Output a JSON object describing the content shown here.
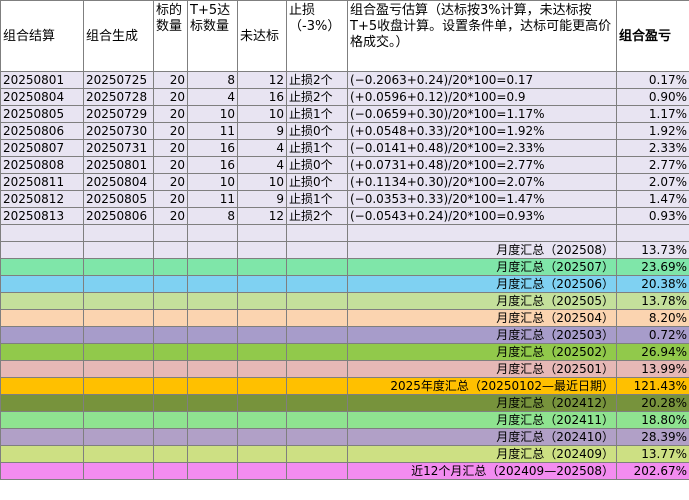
{
  "headers": {
    "col1": "组合结算",
    "col2": "组合生成",
    "col3": "标的数量",
    "col4": "T+5达标数量",
    "col5": "未达标",
    "col6": "止损（-3%）",
    "col7": "组合盈亏估算（达标按3%计算，未达标按T+5收盘计算。设置条件单，达标可能更高价格成交。）",
    "col8": "组合盈亏"
  },
  "rows": [
    {
      "settle": "20250801",
      "gen": "20250725",
      "count": "20",
      "hit": "8",
      "miss": "12",
      "stop": "止损2个",
      "calc": "(−0.2063+0.24)/20*100=0.17",
      "pnl": "0.17%"
    },
    {
      "settle": "20250804",
      "gen": "20250728",
      "count": "20",
      "hit": "4",
      "miss": "16",
      "stop": "止损2个",
      "calc": "(+0.0596+0.12)/20*100=0.9",
      "pnl": "0.90%"
    },
    {
      "settle": "20250805",
      "gen": "20250729",
      "count": "20",
      "hit": "10",
      "miss": "10",
      "stop": "止损1个",
      "calc": "(−0.0659+0.30)/20*100=1.17%",
      "pnl": "1.17%"
    },
    {
      "settle": "20250806",
      "gen": "20250730",
      "count": "20",
      "hit": "11",
      "miss": "9",
      "stop": "止损0个",
      "calc": "(+0.0548+0.33)/20*100=1.92%",
      "pnl": "1.92%"
    },
    {
      "settle": "20250807",
      "gen": "20250731",
      "count": "20",
      "hit": "16",
      "miss": "4",
      "stop": "止损1个",
      "calc": "(−0.0141+0.48)/20*100=2.33%",
      "pnl": "2.33%"
    },
    {
      "settle": "20250808",
      "gen": "20250801",
      "count": "20",
      "hit": "16",
      "miss": "4",
      "stop": "止损0个",
      "calc": "(+0.0731+0.48)/20*100=2.77%",
      "pnl": "2.77%"
    },
    {
      "settle": "20250811",
      "gen": "20250804",
      "count": "20",
      "hit": "10",
      "miss": "10",
      "stop": "止损0个",
      "calc": "(+0.1134+0.30)/20*100=2.07%",
      "pnl": "2.07%"
    },
    {
      "settle": "20250812",
      "gen": "20250805",
      "count": "20",
      "hit": "11",
      "miss": "9",
      "stop": "止损1个",
      "calc": "(−0.0353+0.33)/20*100=1.47%",
      "pnl": "1.47%"
    },
    {
      "settle": "20250813",
      "gen": "20250806",
      "count": "20",
      "hit": "8",
      "miss": "12",
      "stop": "止损2个",
      "calc": "(−0.0543+0.24)/20*100=0.93%",
      "pnl": "0.93%"
    }
  ],
  "summaries": [
    {
      "label": "月度汇总（202508）",
      "value": "13.73%",
      "color": "#e8e4f2"
    },
    {
      "label": "月度汇总（202507）",
      "value": "23.69%",
      "color": "#7fe6a9"
    },
    {
      "label": "月度汇总（202506）",
      "value": "20.38%",
      "color": "#7fd1f2"
    },
    {
      "label": "月度汇总（202505）",
      "value": "13.78%",
      "color": "#c4e09b"
    },
    {
      "label": "月度汇总（202504）",
      "value": "8.20%",
      "color": "#fbd4b0"
    },
    {
      "label": "月度汇总（202503）",
      "value": "0.72%",
      "color": "#a79cca"
    },
    {
      "label": "月度汇总（202502）",
      "value": "26.94%",
      "color": "#91c94b"
    },
    {
      "label": "月度汇总（202501）",
      "value": "13.99%",
      "color": "#e6b8b6"
    },
    {
      "label": "2025年度汇总（20250102—最近日期）",
      "value": "121.43%",
      "color": "#ffc000"
    },
    {
      "label": "月度汇总（202412）",
      "value": "20.28%",
      "color": "#77933c"
    },
    {
      "label": "月度汇总（202411）",
      "value": "18.80%",
      "color": "#8fe390"
    },
    {
      "label": "月度汇总（202410）",
      "value": "28.39%",
      "color": "#b1a0c7"
    },
    {
      "label": "月度汇总（202409）",
      "value": "13.77%",
      "color": "#cde083"
    },
    {
      "label": "近12个月汇总（202409—202508）",
      "value": "202.67%",
      "color": "#f38cf0"
    }
  ]
}
